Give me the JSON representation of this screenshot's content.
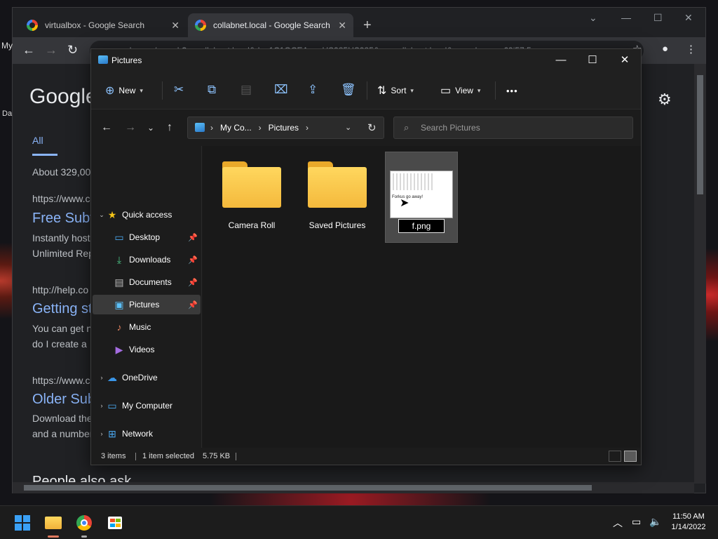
{
  "chrome": {
    "tabs": [
      {
        "title": "virtualbox - Google Search",
        "close": "✕"
      },
      {
        "title": "collabnet.local - Google Search",
        "close": "✕"
      }
    ],
    "new_tab": "+",
    "url": "google.com/search?q=collabnet.local&rlz=1C1GCEA_enUS985US985&oq=collabnet.local&aqs=chrome..69i57.5",
    "page": {
      "logo": "Google",
      "tab_all": "All",
      "result_count": "About 329,00",
      "results": [
        {
          "url": "https://www.c",
          "title": "Free Subv",
          "snippet1": "Instantly host",
          "snippet2": "Unlimited Rep"
        },
        {
          "url": "http://help.co",
          "title": "Getting st",
          "snippet1": "You can get n",
          "snippet2": "do I create a I"
        },
        {
          "url": "https://www.c",
          "title": "Older Sub",
          "snippet1": "Download the",
          "snippet2": "and a number"
        }
      ],
      "people_also_ask": "People also ask",
      "left_labels": {
        "my": "My",
        "day": "Da"
      }
    }
  },
  "explorer": {
    "title": "Pictures",
    "ribbon": {
      "new_label": "New",
      "sort_label": "Sort",
      "view_label": "View",
      "more": "•••"
    },
    "address": {
      "crumbs": [
        "My Co...",
        "Pictures"
      ]
    },
    "search": {
      "placeholder": "Search Pictures"
    },
    "sidebar": [
      {
        "label": "Quick access",
        "icon": "star-icon",
        "expander": "expanded",
        "pinned": false
      },
      {
        "label": "Desktop",
        "icon": "desktop-icon",
        "pinned": true
      },
      {
        "label": "Downloads",
        "icon": "download-icon",
        "pinned": true
      },
      {
        "label": "Documents",
        "icon": "document-icon",
        "pinned": true
      },
      {
        "label": "Pictures",
        "icon": "pictures-icon",
        "pinned": true,
        "selected": true
      },
      {
        "label": "Music",
        "icon": "music-icon",
        "pinned": false
      },
      {
        "label": "Videos",
        "icon": "video-icon",
        "pinned": false
      },
      {
        "label": "OneDrive",
        "icon": "cloud-icon",
        "expander": "collapsed"
      },
      {
        "label": "My Computer",
        "icon": "computer-icon",
        "expander": "collapsed"
      },
      {
        "label": "Network",
        "icon": "network-icon",
        "expander": "collapsed"
      }
    ],
    "files": [
      {
        "name": "Camera Roll",
        "type": "folder"
      },
      {
        "name": "Saved Pictures",
        "type": "folder"
      },
      {
        "name": "f.png",
        "type": "image",
        "selected": true,
        "renaming": true,
        "thumb_text": "Forkus go away!"
      }
    ],
    "status": {
      "items": "3 items",
      "selected": "1 item selected",
      "size": "5.75 KB"
    }
  },
  "taskbar": {
    "time": "11:50 AM",
    "date": "1/14/2022"
  },
  "colors": {
    "accent": "#8ec4ff",
    "folder": "#f4b93c",
    "link": "#8ab4f8"
  }
}
